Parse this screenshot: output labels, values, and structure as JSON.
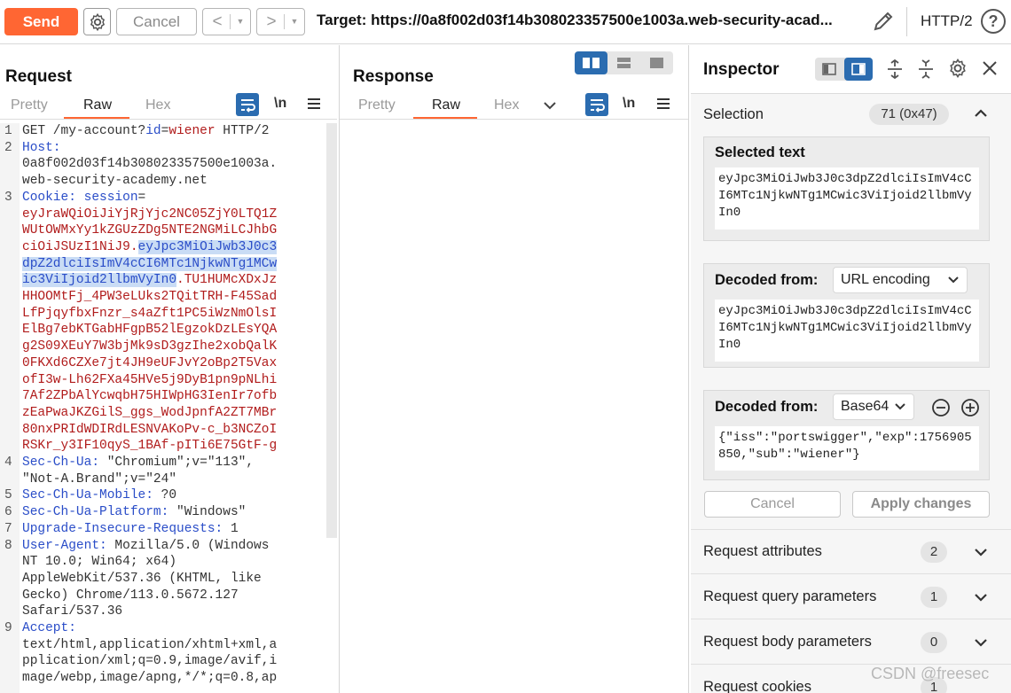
{
  "toolbar": {
    "send_label": "Send",
    "cancel_label": "Cancel",
    "back_arrow": "<",
    "forward_arrow": ">",
    "drop_glyph": "▼",
    "target_text": "Target: https://0a8f002d03f14b308023357500e1003a.web-security-acad...",
    "protocol_label": "HTTP/2",
    "help_glyph": "?"
  },
  "request": {
    "title": "Request",
    "tabs": [
      "Pretty",
      "Raw",
      "Hex"
    ],
    "active_tab": "Raw",
    "newline_glyph": "\\n",
    "lines": [
      {
        "n": "1",
        "segs": [
          {
            "t": "GET /my-account?",
            "c": "v"
          },
          {
            "t": "id",
            "c": "k"
          },
          {
            "t": "=",
            "c": "v"
          },
          {
            "t": "wiener",
            "c": "c"
          },
          {
            "t": " HTTP/2",
            "c": "v"
          }
        ]
      },
      {
        "n": "2",
        "segs": [
          {
            "t": "Host:",
            "c": "k"
          }
        ]
      },
      {
        "n": "",
        "segs": [
          {
            "t": "0a8f002d03f14b308023357500e1003a.",
            "c": "v"
          }
        ]
      },
      {
        "n": "",
        "segs": [
          {
            "t": "web-security-academy.net",
            "c": "v"
          }
        ]
      },
      {
        "n": "3",
        "segs": [
          {
            "t": "Cookie: ",
            "c": "k"
          },
          {
            "t": "session",
            "c": "k"
          },
          {
            "t": "=",
            "c": "v"
          }
        ]
      },
      {
        "n": "",
        "segs": [
          {
            "t": "eyJraWQiOiJiYjRjYjc2NC05ZjY0LTQ1Z",
            "c": "c"
          }
        ]
      },
      {
        "n": "",
        "segs": [
          {
            "t": "WUtOWMxYy1kZGUzZDg5NTE2NGMiLCJhbG",
            "c": "c"
          }
        ]
      },
      {
        "n": "",
        "segs": [
          {
            "t": "ciOiJSUzI1NiJ9.",
            "c": "c"
          },
          {
            "t": "eyJpc3MiOiJwb3J0c3",
            "c": "sel"
          }
        ]
      },
      {
        "n": "",
        "segs": [
          {
            "t": "dpZ2dlciIsImV4cCI6MTc1NjkwNTg1MCw",
            "c": "sel"
          }
        ]
      },
      {
        "n": "",
        "segs": [
          {
            "t": "ic3ViIjoid2llbmVyIn0",
            "c": "sel"
          },
          {
            "t": ".TU1HUMcXDxJz",
            "c": "c"
          }
        ]
      },
      {
        "n": "",
        "segs": [
          {
            "t": "HHOOMtFj_4PW3eLUks2TQitTRH-F45Sad",
            "c": "c"
          }
        ]
      },
      {
        "n": "",
        "segs": [
          {
            "t": "LfPjqyfbxFnzr_s4aZft1PC5iWzNmOlsI",
            "c": "c"
          }
        ]
      },
      {
        "n": "",
        "segs": [
          {
            "t": "ElBg7ebKTGabHFgpB52lEgzokDzLEsYQA",
            "c": "c"
          }
        ]
      },
      {
        "n": "",
        "segs": [
          {
            "t": "g2S09XEuY7W3bjMk9sD3gzIhe2xobQalK",
            "c": "c"
          }
        ]
      },
      {
        "n": "",
        "segs": [
          {
            "t": "0FKXd6CZXe7jt4JH9eUFJvY2oBp2T5Vax",
            "c": "c"
          }
        ]
      },
      {
        "n": "",
        "segs": [
          {
            "t": "ofI3w-Lh62FXa45HVe5j9DyB1pn9pNLhi",
            "c": "c"
          }
        ]
      },
      {
        "n": "",
        "segs": [
          {
            "t": "7Af2ZPbAlYcwqbH75HIWpHG3IenIr7ofb",
            "c": "c"
          }
        ]
      },
      {
        "n": "",
        "segs": [
          {
            "t": "zEaPwaJKZGilS_ggs_WodJpnfA2ZT7MBr",
            "c": "c"
          }
        ]
      },
      {
        "n": "",
        "segs": [
          {
            "t": "80nxPRIdWDIRdLESNVAKoPv-c_b3NCZoI",
            "c": "c"
          }
        ]
      },
      {
        "n": "",
        "segs": [
          {
            "t": "RSKr_y3IF10qyS_1BAf-pITi6E75GtF-g",
            "c": "c"
          }
        ]
      },
      {
        "n": "4",
        "segs": [
          {
            "t": "Sec-Ch-Ua:",
            "c": "k"
          },
          {
            "t": " \"Chromium\";v=\"113\",",
            "c": "v"
          }
        ]
      },
      {
        "n": "",
        "segs": [
          {
            "t": "\"Not-A.Brand\";v=\"24\"",
            "c": "v"
          }
        ]
      },
      {
        "n": "5",
        "segs": [
          {
            "t": "Sec-Ch-Ua-Mobile:",
            "c": "k"
          },
          {
            "t": " ?0",
            "c": "v"
          }
        ]
      },
      {
        "n": "6",
        "segs": [
          {
            "t": "Sec-Ch-Ua-Platform:",
            "c": "k"
          },
          {
            "t": " \"Windows\"",
            "c": "v"
          }
        ]
      },
      {
        "n": "7",
        "segs": [
          {
            "t": "Upgrade-Insecure-Requests:",
            "c": "k"
          },
          {
            "t": " 1",
            "c": "v"
          }
        ]
      },
      {
        "n": "8",
        "segs": [
          {
            "t": "User-Agent:",
            "c": "k"
          },
          {
            "t": " Mozilla/5.0 (Windows",
            "c": "v"
          }
        ]
      },
      {
        "n": "",
        "segs": [
          {
            "t": "NT 10.0; Win64; x64)",
            "c": "v"
          }
        ]
      },
      {
        "n": "",
        "segs": [
          {
            "t": "AppleWebKit/537.36 (KHTML, like",
            "c": "v"
          }
        ]
      },
      {
        "n": "",
        "segs": [
          {
            "t": "Gecko) Chrome/113.0.5672.127",
            "c": "v"
          }
        ]
      },
      {
        "n": "",
        "segs": [
          {
            "t": "Safari/537.36",
            "c": "v"
          }
        ]
      },
      {
        "n": "9",
        "segs": [
          {
            "t": "Accept:",
            "c": "k"
          }
        ]
      },
      {
        "n": "",
        "segs": [
          {
            "t": "text/html,application/xhtml+xml,a",
            "c": "v"
          }
        ]
      },
      {
        "n": "",
        "segs": [
          {
            "t": "pplication/xml;q=0.9,image/avif,i",
            "c": "v"
          }
        ]
      },
      {
        "n": "",
        "segs": [
          {
            "t": "mage/webp,image/apng,*/*;q=0.8,ap",
            "c": "v"
          }
        ]
      }
    ]
  },
  "response": {
    "title": "Response",
    "tabs": [
      "Pretty",
      "Raw",
      "Hex"
    ],
    "active_tab": "Raw",
    "newline_glyph": "\\n"
  },
  "inspector": {
    "title": "Inspector",
    "selection_label": "Selection",
    "selection_count": "71 (0x47)",
    "selected_text_title": "Selected text",
    "selected_text": "eyJpc3MiOiJwb3J0c3dpZ2dlciIsImV4cCI6MTc1NjkwNTg1MCwic3ViIjoid2llbmVyIn0",
    "decoded1_title": "Decoded from:",
    "decoded1_encoding": "URL encoding",
    "decoded1_text": "eyJpc3MiOiJwb3J0c3dpZ2dlciIsImV4cCI6MTc1NjkwNTg1MCwic3ViIjoid2llbmVyIn0",
    "decoded2_title": "Decoded from:",
    "decoded2_encoding": "Base64",
    "decoded2_text": "{\"iss\":\"portswigger\",\"exp\":1756905850,\"sub\":\"wiener\"}",
    "cancel_label": "Cancel",
    "apply_label": "Apply changes",
    "sections": [
      {
        "label": "Request attributes",
        "count": "2"
      },
      {
        "label": "Request query parameters",
        "count": "1"
      },
      {
        "label": "Request body parameters",
        "count": "0"
      },
      {
        "label": "Request cookies",
        "count": "1"
      }
    ]
  },
  "watermark": "CSDN @freesec",
  "colors": {
    "accent": "#ff6633",
    "selected_blue": "#2b6cb0",
    "code_red": "#b11c1c",
    "code_key": "#2a4dc8"
  }
}
